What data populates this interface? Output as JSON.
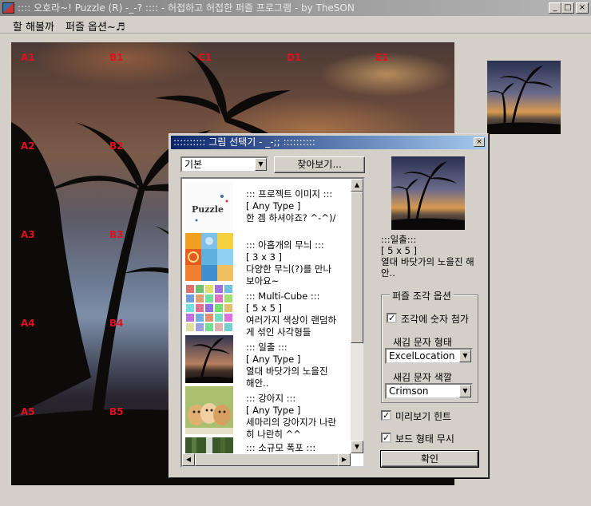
{
  "window": {
    "title": ":::: 오호라~! Puzzle (R) -_-? :::: - 허접하고 허접한 퍼즐 프로그램 - by TheSON",
    "minimize": "_",
    "maximize": "□",
    "close": "×"
  },
  "menu": {
    "items": [
      "할 해볼까",
      "퍼즐 옵션~♬"
    ]
  },
  "puzzle": {
    "cell_labels": [
      "A1",
      "B1",
      "C1",
      "D1",
      "E1",
      "A2",
      "B2",
      "A3",
      "B3",
      "A4",
      "B4",
      "A5",
      "B5"
    ]
  },
  "dialog": {
    "title": ":::::::::: 그림 선택기 - _-;; ::::::::::",
    "close": "×",
    "category_select": "기본",
    "browse_button": "찾아보기...",
    "items": [
      {
        "line1": "::: 프로젝트 이미지 :::",
        "line2": "[ Any Type ]",
        "line3": "한 겜 하셔야죠? ^-^)/",
        "line4": "",
        "thumb": "project-thumb"
      },
      {
        "line1": "::: 아홉개의 무늬 :::",
        "line2": "[ 3 x 3 ]",
        "line3": "다양한 무늬(?)를 만나",
        "line4": "보아요~",
        "thumb": "pattern-thumb"
      },
      {
        "line1": "::: Multi-Cube :::",
        "line2": "[ 5 x 5 ]",
        "line3": "여러가지 색상이 랜덤하",
        "line4": "게 섞인 사각형들",
        "thumb": "cube-thumb"
      },
      {
        "line1": "::: 일출 :::",
        "line2": "[ Any Type ]",
        "line3": "열대 바닷가의 노을진",
        "line4": "해안..",
        "thumb": "sunrise-thumb"
      },
      {
        "line1": "::: 강아지 :::",
        "line2": "[ Any Type ]",
        "line3": "세마리의 강아지가 나란",
        "line4": "히 나란히 ^^",
        "thumb": "puppy-thumb"
      },
      {
        "line1": "::: 소규모 폭포 :::",
        "line2": "",
        "line3": "",
        "line4": "",
        "thumb": "waterfall-thumb"
      }
    ],
    "selected": {
      "title": ":::일출:::",
      "size": "[ 5 x 5 ]",
      "desc": "열대 바닷가의 노을진 해안.."
    },
    "options": {
      "legend": "퍼즐 조각 옵션",
      "number_checkbox": {
        "label": "조각에 숫자 첨가",
        "checked": true,
        "mark": "✓"
      },
      "format_label": "새김 문자 형태",
      "format_value": "ExcelLocation",
      "color_label": "새김 문자 색깔",
      "color_value": "Crimson"
    },
    "hint_checkbox": {
      "label": "미리보기 힌트",
      "checked": true,
      "mark": "✓"
    },
    "ignore_checkbox": {
      "label": "보드 형태 무시",
      "checked": true,
      "mark": "✓"
    },
    "ok_button": "확인"
  }
}
